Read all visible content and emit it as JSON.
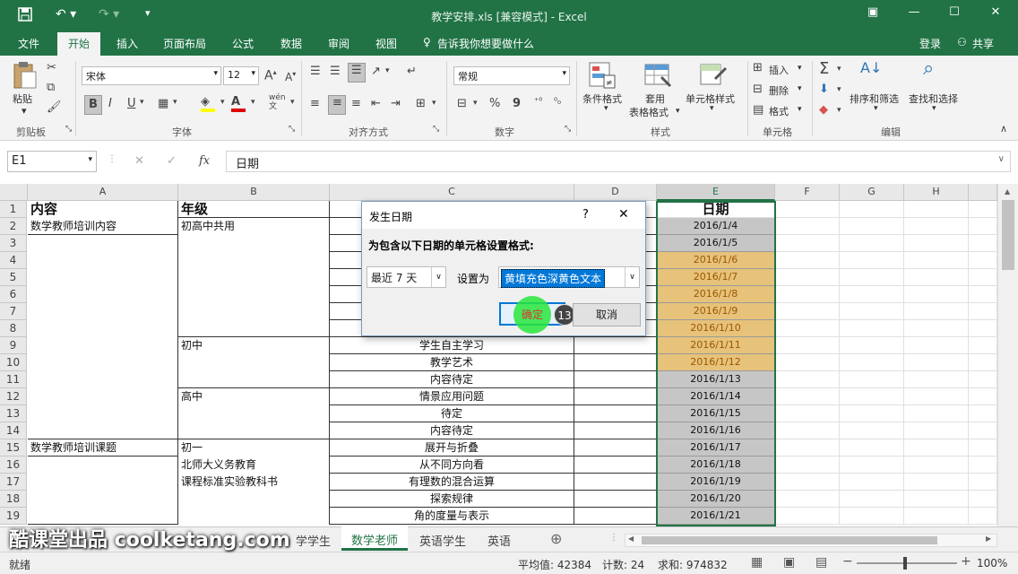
{
  "window": {
    "title": "教学安排.xls  [兼容模式] - Excel",
    "undo_icon": "undo-icon",
    "redo_icon": "redo-icon"
  },
  "menu": {
    "items": [
      "文件",
      "开始",
      "插入",
      "页面布局",
      "公式",
      "数据",
      "审阅",
      "视图"
    ],
    "active": "开始",
    "tell_me": "告诉我你想要做什么",
    "login": "登录",
    "share": "共享"
  },
  "ribbon": {
    "clipboard": {
      "paste": "粘贴",
      "label": "剪贴板"
    },
    "font": {
      "name": "宋体",
      "size": "12",
      "label": "字体",
      "bold": "B",
      "italic": "I",
      "underline": "U",
      "grow": "A",
      "shrink": "A",
      "wen": "wén",
      "fontcolor": "A"
    },
    "align": {
      "label": "对齐方式"
    },
    "number": {
      "format": "常规",
      "label": "数字",
      "percent": "%",
      "comma": "9"
    },
    "styles": {
      "cond": "条件格式",
      "table1": "套用",
      "table2": "表格格式",
      "cell": "单元格样式",
      "label": "样式"
    },
    "cells": {
      "insert": "插入",
      "delete": "删除",
      "format": "格式",
      "label": "单元格"
    },
    "editing": {
      "sort": "排序和筛选",
      "find": "查找和选择",
      "label": "编辑"
    }
  },
  "formula": {
    "namebox": "E1",
    "fx": "fx",
    "value": "日期"
  },
  "columns": [
    "A",
    "B",
    "C",
    "D",
    "E",
    "F",
    "G",
    "H"
  ],
  "rows": [
    "1",
    "2",
    "3",
    "4",
    "5",
    "6",
    "7",
    "8",
    "9",
    "10",
    "11",
    "12",
    "13",
    "14",
    "15",
    "16",
    "17",
    "18",
    "19"
  ],
  "cells": {
    "A1": "内容",
    "B1": "年级",
    "E1": "日期",
    "A2": "数学教师培训内容",
    "B2": "初高中共用",
    "B9": "初中",
    "B12": "高中",
    "A15": "数学教师培训课题",
    "B15": "初一",
    "B16": "北师大义务教育",
    "B17": "课程标准实验教科书",
    "C9": "学生自主学习",
    "C10": "教学艺术",
    "C11": "内容待定",
    "C12": "情景应用问题",
    "C13": "待定",
    "C14": "内容待定",
    "C15": "展开与折叠",
    "C16": "从不同方向看",
    "C17": "有理数的混合运算",
    "C18": "探索规律",
    "C19": "角的度量与表示",
    "dates": [
      "2016/1/4",
      "2016/1/5",
      "2016/1/6",
      "2016/1/7",
      "2016/1/8",
      "2016/1/9",
      "2016/1/10",
      "2016/1/11",
      "2016/1/12",
      "2016/1/13",
      "2016/1/14",
      "2016/1/15",
      "2016/1/16",
      "2016/1/17",
      "2016/1/18",
      "2016/1/19",
      "2016/1/20",
      "2016/1/21"
    ]
  },
  "dialog": {
    "title": "发生日期",
    "help": "?",
    "close": "✕",
    "prompt": "为包含以下日期的单元格设置格式:",
    "period": "最近 7 天",
    "set_as": "设置为",
    "style": "黄填充色深黄色文本",
    "ok": "确定",
    "cancel": "取消",
    "step": "13"
  },
  "tabs": [
    "学学生",
    "数学老师",
    "英语学生",
    "英语"
  ],
  "active_tab": "数学老师",
  "status": {
    "ready": "就绪",
    "average": "平均值: 42384",
    "count": "计数: 24",
    "sum": "求和: 974832",
    "zoom": "100%"
  },
  "watermark": "酷课堂出品 coolketang.com",
  "colors": {
    "excel_green": "#217346",
    "highlight_fill": "#ffeb9c",
    "highlight_text": "#9c5700",
    "selection": "#c6c6c6"
  }
}
